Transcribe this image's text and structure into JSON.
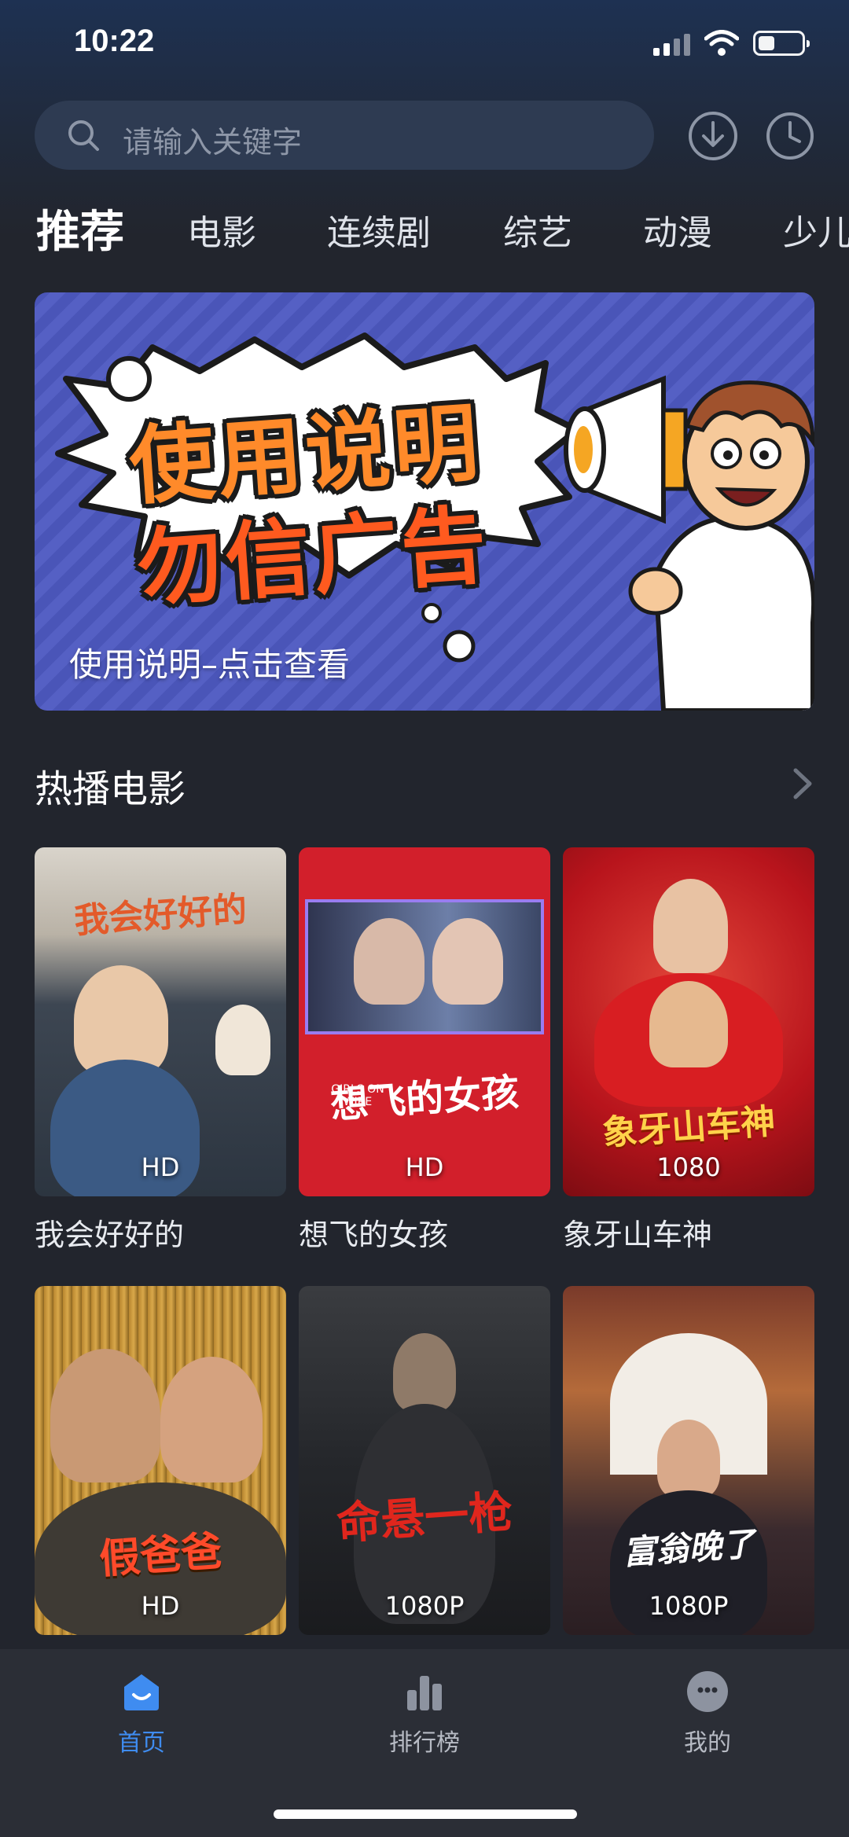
{
  "status_bar": {
    "time": "10:22"
  },
  "search": {
    "placeholder": "请输入关键字"
  },
  "tabs": [
    {
      "label": "推荐",
      "active": true
    },
    {
      "label": "电影"
    },
    {
      "label": "连续剧"
    },
    {
      "label": "综艺"
    },
    {
      "label": "动漫"
    },
    {
      "label": "少儿"
    }
  ],
  "banner": {
    "headline_1": "使用说明",
    "headline_2": "勿信广告",
    "caption": "使用说明–点击查看"
  },
  "hot_movies": {
    "title": "热播电影",
    "items": [
      {
        "title": "我会好好的",
        "quality": "HD",
        "poster_text": "我会好好的"
      },
      {
        "title": "想飞的女孩",
        "quality": "HD",
        "poster_text": "想飞的女孩",
        "poster_subtext": "GIRLS ON WIRE"
      },
      {
        "title": "象牙山车神",
        "quality": "1080",
        "poster_text": "象牙山车神"
      },
      {
        "title": "",
        "quality": "HD",
        "poster_text": "假爸爸"
      },
      {
        "title": "",
        "quality": "1080P",
        "poster_text": "命悬一枪"
      },
      {
        "title": "",
        "quality": "1080P",
        "poster_text": "富翁晚了"
      }
    ]
  },
  "bottom_nav": [
    {
      "label": "首页",
      "icon": "home-icon",
      "active": true
    },
    {
      "label": "排行榜",
      "icon": "ranking-icon"
    },
    {
      "label": "我的",
      "icon": "profile-icon"
    }
  ],
  "colors": {
    "accent": "#3f8cf0",
    "background": "#22252d",
    "banner": "#4a55b8"
  }
}
